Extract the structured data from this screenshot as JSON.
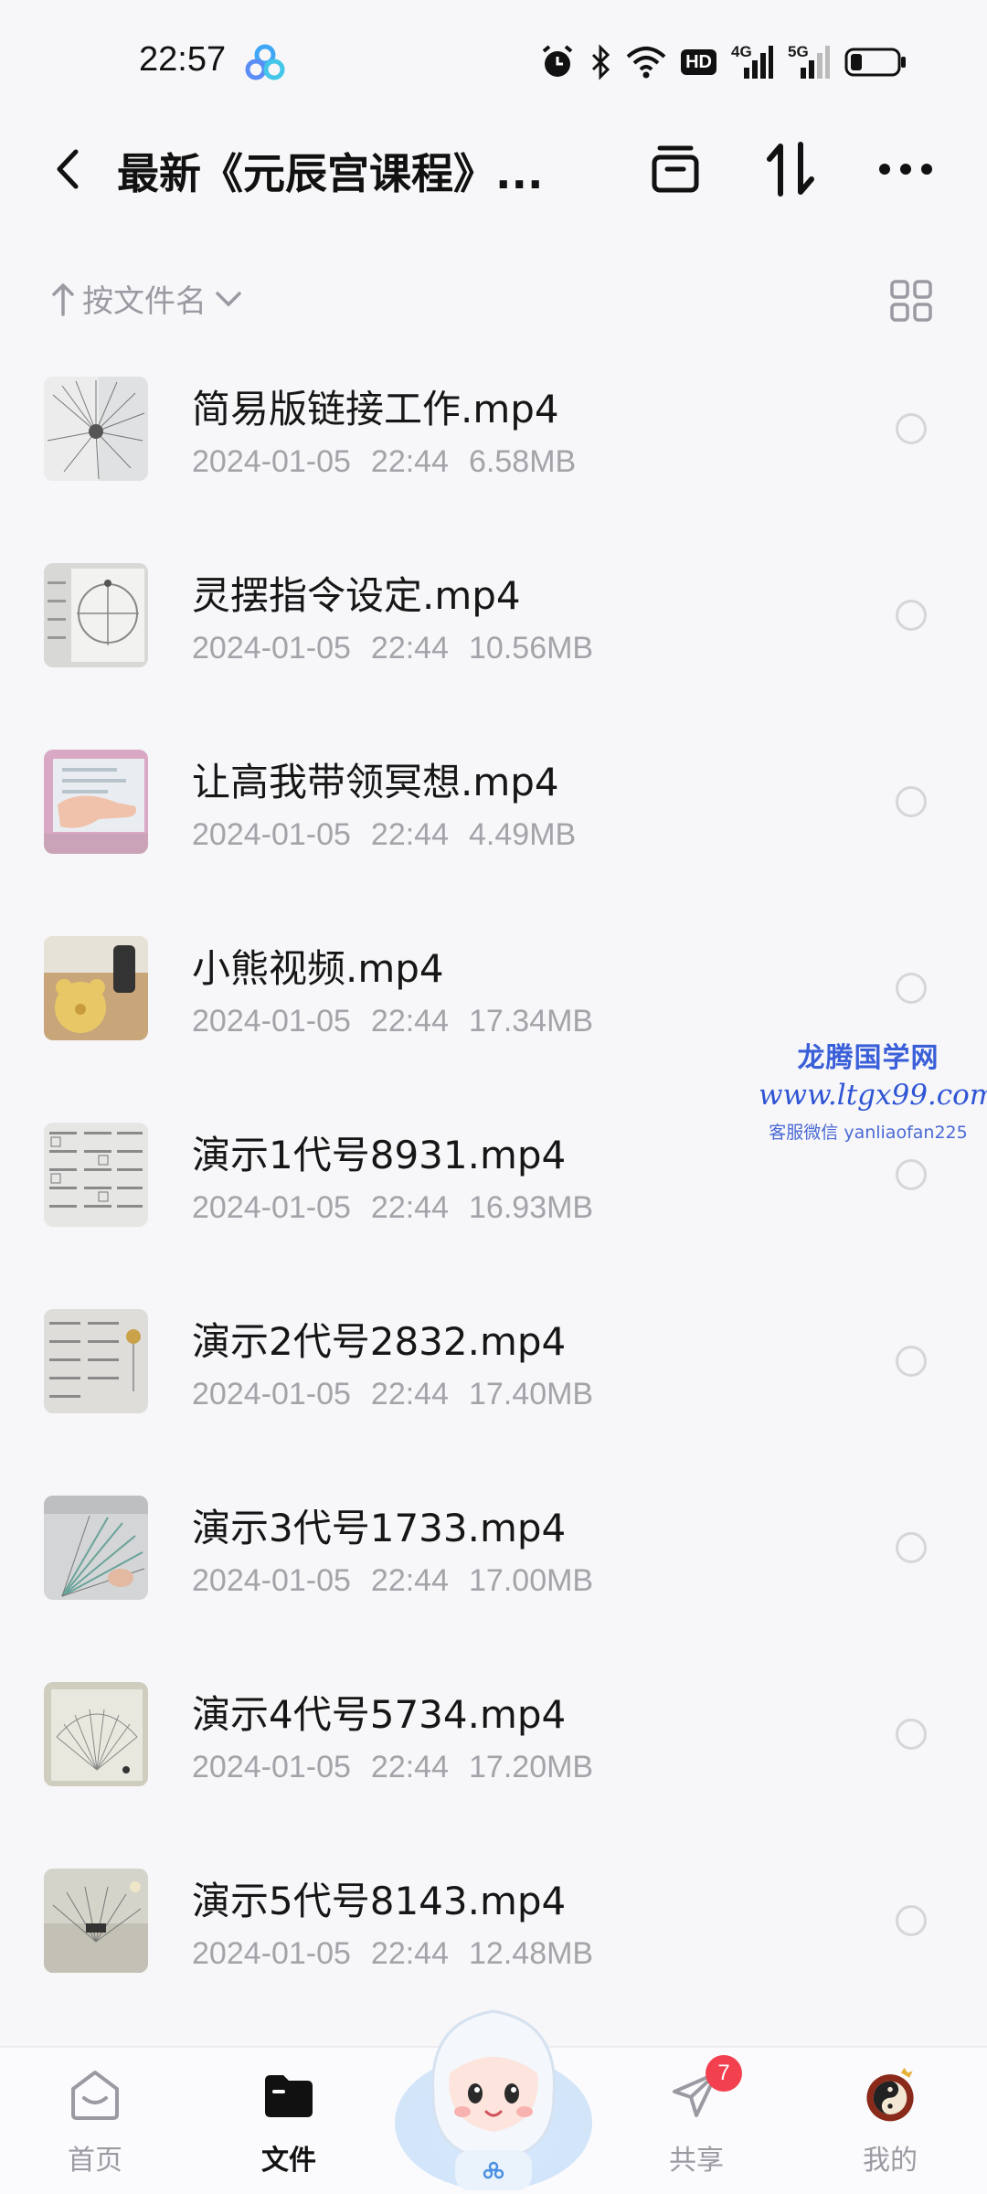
{
  "status_bar": {
    "time": "22:57",
    "net_hd": "HD",
    "net_4g": "4G",
    "net_5g": "5G"
  },
  "header": {
    "title": "最新《元辰宫课程》..."
  },
  "sort": {
    "label": "按文件名"
  },
  "files": [
    {
      "name": "简易版链接工作.mp4",
      "date": "2024-01-05",
      "time": "22:44",
      "size": "6.58MB",
      "thumb": "chart"
    },
    {
      "name": "灵摆指令设定.mp4",
      "date": "2024-01-05",
      "time": "22:44",
      "size": "10.56MB",
      "thumb": "dial"
    },
    {
      "name": "让高我带领冥想.mp4",
      "date": "2024-01-05",
      "time": "22:44",
      "size": "4.49MB",
      "thumb": "hand"
    },
    {
      "name": "小熊视频.mp4",
      "date": "2024-01-05",
      "time": "22:44",
      "size": "17.34MB",
      "thumb": "bear"
    },
    {
      "name": "演示1代号8931.mp4",
      "date": "2024-01-05",
      "time": "22:44",
      "size": "16.93MB",
      "thumb": "sheet"
    },
    {
      "name": "演示2代号2832.mp4",
      "date": "2024-01-05",
      "time": "22:44",
      "size": "17.40MB",
      "thumb": "sheet2"
    },
    {
      "name": "演示3代号1733.mp4",
      "date": "2024-01-05",
      "time": "22:44",
      "size": "17.00MB",
      "thumb": "fan"
    },
    {
      "name": "演示4代号5734.mp4",
      "date": "2024-01-05",
      "time": "22:44",
      "size": "17.20MB",
      "thumb": "fan2"
    },
    {
      "name": "演示5代号8143.mp4",
      "date": "2024-01-05",
      "time": "22:44",
      "size": "12.48MB",
      "thumb": "fan3"
    }
  ],
  "watermark": {
    "title": "龙腾国学网",
    "url": "www.ltgx99.com",
    "contact": "客服微信 yanliaofan225"
  },
  "nav": {
    "home": "首页",
    "files": "文件",
    "share": "共享",
    "share_badge": "7",
    "me": "我的"
  },
  "colors": {
    "background": "#f7f7f9",
    "primary_text": "#161616",
    "secondary_text": "#a3a3aa",
    "badge": "#f2404f",
    "watermark": "#3a5fd9"
  }
}
